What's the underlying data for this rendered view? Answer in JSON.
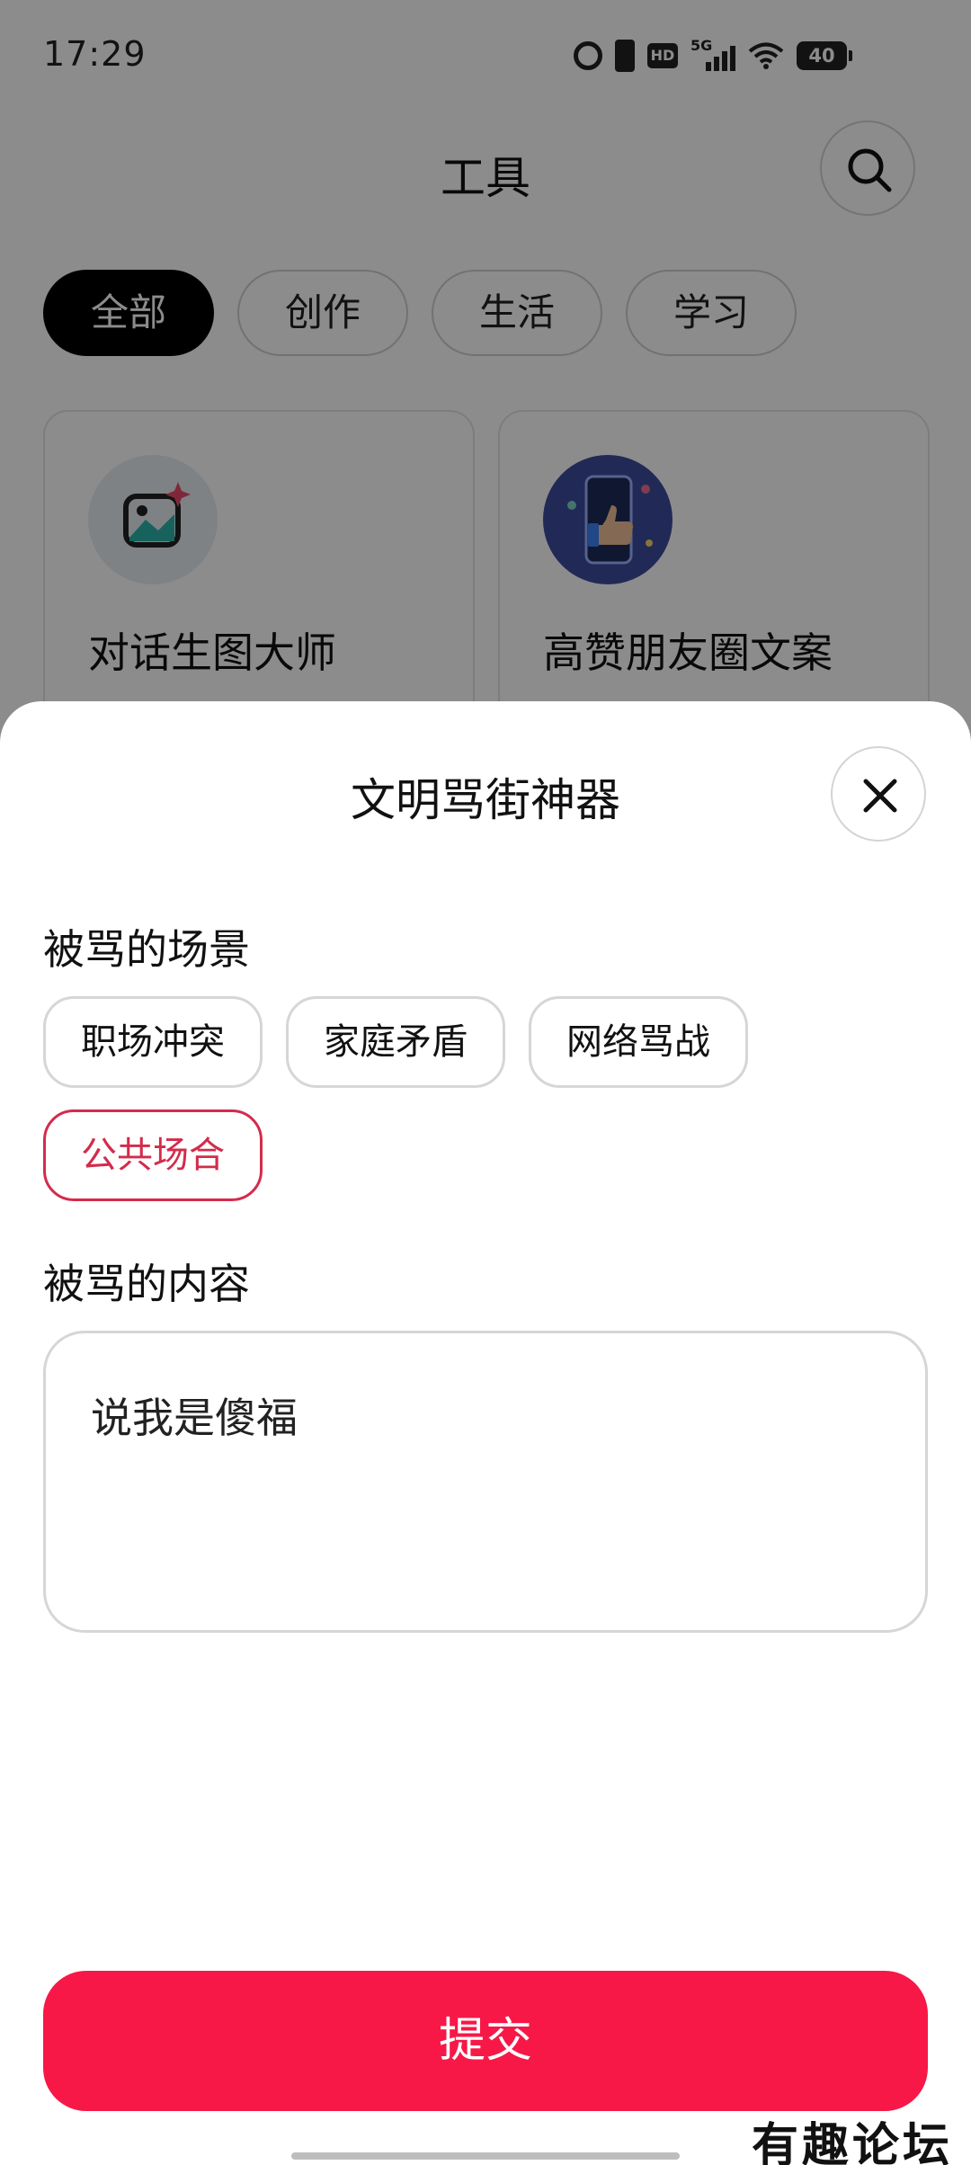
{
  "status_bar": {
    "time": "17:29",
    "icons": [
      "alarm-icon",
      "vibrate-icon",
      "hd-icon",
      "signal-5g-icon",
      "wifi-icon",
      "battery-icon"
    ],
    "hd_label": "HD",
    "network_label": "5G",
    "battery_level": "40"
  },
  "header": {
    "title": "工具",
    "search_icon": "search-icon"
  },
  "filter_tabs": [
    {
      "label": "全部",
      "active": true
    },
    {
      "label": "创作",
      "active": false
    },
    {
      "label": "生活",
      "active": false
    },
    {
      "label": "学习",
      "active": false
    }
  ],
  "tool_cards": [
    {
      "name": "对话生图大师",
      "icon": "image-sparkle-icon"
    },
    {
      "name": "高赞朋友圈文案",
      "icon": "thumbs-up-phone-icon"
    }
  ],
  "sheet": {
    "title": "文明骂街神器",
    "close_icon": "close-icon",
    "scene_label": "被骂的场景",
    "scene_options": [
      {
        "label": "职场冲突",
        "selected": false
      },
      {
        "label": "家庭矛盾",
        "selected": false
      },
      {
        "label": "网络骂战",
        "selected": false
      },
      {
        "label": "公共场合",
        "selected": true
      }
    ],
    "content_label": "被骂的内容",
    "content_value": "说我是傻福",
    "submit_label": "提交"
  },
  "watermark": "有趣论坛",
  "colors": {
    "accent": "#f71847",
    "selected_chip": "#d42b4c",
    "active_tab_bg": "#000000"
  }
}
